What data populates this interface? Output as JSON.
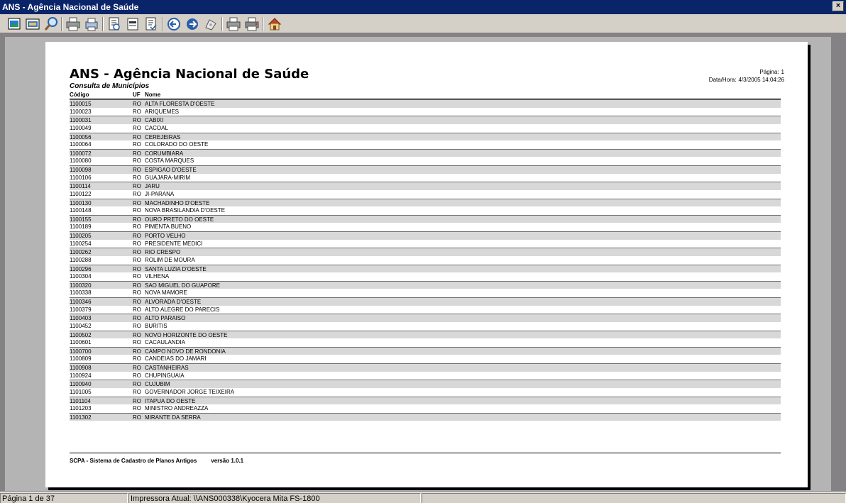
{
  "window": {
    "title": "ANS - Agência Nacional de Saúde",
    "close_label": "×"
  },
  "toolbar": {
    "buttons": [
      "export-icon",
      "image-icon",
      "zoom-icon",
      "print-icon",
      "print-setup-icon",
      "first-page-icon",
      "page-icon",
      "last-page-icon",
      "previous-icon",
      "next-icon",
      "find-icon",
      "printer-icon",
      "printer-alt-icon",
      "exit-icon"
    ]
  },
  "report": {
    "title": "ANS - Agência Nacional de Saúde",
    "subtitle": "Consulta de Municípios",
    "page_label": "Página:",
    "page_value": "1",
    "datetime_label": "Data/Hora:",
    "datetime_value": "4/3/2005 14:04:26",
    "columns": {
      "code": "Código",
      "uf": "UF",
      "name": "Nome"
    },
    "rows": [
      {
        "code": "1100015",
        "uf": "RO",
        "name": "ALTA FLORESTA D'OESTE"
      },
      {
        "code": "1100023",
        "uf": "RO",
        "name": "ARIQUEMES"
      },
      {
        "code": "1100031",
        "uf": "RO",
        "name": "CABIXI"
      },
      {
        "code": "1100049",
        "uf": "RO",
        "name": "CACOAL"
      },
      {
        "code": "1100056",
        "uf": "RO",
        "name": "CEREJEIRAS"
      },
      {
        "code": "1100064",
        "uf": "RO",
        "name": "COLORADO DO OESTE"
      },
      {
        "code": "1100072",
        "uf": "RO",
        "name": "CORUMBIARA"
      },
      {
        "code": "1100080",
        "uf": "RO",
        "name": "COSTA MARQUES"
      },
      {
        "code": "1100098",
        "uf": "RO",
        "name": "ESPIGAO D'OESTE"
      },
      {
        "code": "1100106",
        "uf": "RO",
        "name": "GUAJARA-MIRIM"
      },
      {
        "code": "1100114",
        "uf": "RO",
        "name": "JARU"
      },
      {
        "code": "1100122",
        "uf": "RO",
        "name": "JI-PARANA"
      },
      {
        "code": "1100130",
        "uf": "RO",
        "name": "MACHADINHO D'OESTE"
      },
      {
        "code": "1100148",
        "uf": "RO",
        "name": "NOVA BRASILANDIA D'OESTE"
      },
      {
        "code": "1100155",
        "uf": "RO",
        "name": "OURO PRETO DO OESTE"
      },
      {
        "code": "1100189",
        "uf": "RO",
        "name": "PIMENTA BUENO"
      },
      {
        "code": "1100205",
        "uf": "RO",
        "name": "PORTO VELHO"
      },
      {
        "code": "1100254",
        "uf": "RO",
        "name": "PRESIDENTE MEDICI"
      },
      {
        "code": "1100262",
        "uf": "RO",
        "name": "RIO CRESPO"
      },
      {
        "code": "1100288",
        "uf": "RO",
        "name": "ROLIM DE MOURA"
      },
      {
        "code": "1100296",
        "uf": "RO",
        "name": "SANTA LUZIA D'OESTE"
      },
      {
        "code": "1100304",
        "uf": "RO",
        "name": "VILHENA"
      },
      {
        "code": "1100320",
        "uf": "RO",
        "name": "SAO MIGUEL DO GUAPORE"
      },
      {
        "code": "1100338",
        "uf": "RO",
        "name": "NOVA MAMORE"
      },
      {
        "code": "1100346",
        "uf": "RO",
        "name": "ALVORADA D'OESTE"
      },
      {
        "code": "1100379",
        "uf": "RO",
        "name": "ALTO ALEGRE DO PARECIS"
      },
      {
        "code": "1100403",
        "uf": "RO",
        "name": "ALTO PARAISO"
      },
      {
        "code": "1100452",
        "uf": "RO",
        "name": "BURITIS"
      },
      {
        "code": "1100502",
        "uf": "RO",
        "name": "NOVO HORIZONTE DO OESTE"
      },
      {
        "code": "1100601",
        "uf": "RO",
        "name": "CACAULANDIA"
      },
      {
        "code": "1100700",
        "uf": "RO",
        "name": "CAMPO NOVO DE RONDONIA"
      },
      {
        "code": "1100809",
        "uf": "RO",
        "name": "CANDEIAS DO JAMARI"
      },
      {
        "code": "1100908",
        "uf": "RO",
        "name": "CASTANHEIRAS"
      },
      {
        "code": "1100924",
        "uf": "RO",
        "name": "CHUPINGUAIA"
      },
      {
        "code": "1100940",
        "uf": "RO",
        "name": "CUJUBIM"
      },
      {
        "code": "1101005",
        "uf": "RO",
        "name": "GOVERNADOR JORGE TEIXEIRA"
      },
      {
        "code": "1101104",
        "uf": "RO",
        "name": "ITAPUA DO OESTE"
      },
      {
        "code": "1101203",
        "uf": "RO",
        "name": "MINISTRO ANDREAZZA"
      },
      {
        "code": "1101302",
        "uf": "RO",
        "name": "MIRANTE DA SERRA"
      }
    ],
    "footer_system": "SCPA - Sistema de Cadastro de Planos Antigos",
    "footer_version": "versão 1.0.1"
  },
  "status": {
    "page_info": "Página 1 de 37",
    "printer": "Impressora Atual: \\\\ANS000338\\Kyocera Mita FS-1800",
    "extra": ""
  },
  "colors": {
    "titlebar": "#0a246a",
    "chrome": "#d4d0c8",
    "workspace": "#848284",
    "row_shade": "#d8d8d8"
  }
}
